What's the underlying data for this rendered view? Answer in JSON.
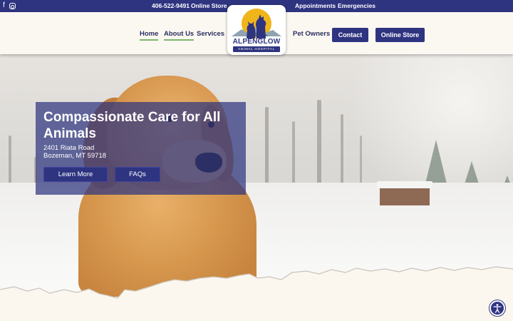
{
  "topbar": {
    "social": {
      "facebook_icon": "f",
      "instagram_icon": "instagram-icon"
    },
    "phone": "406-522-9491",
    "online_store": "Online Store",
    "appointments": "Appointments",
    "emergencies": "Emergencies"
  },
  "nav": {
    "home": "Home",
    "about": "About Us",
    "services": "Services",
    "pet_owners": "Pet Owners",
    "contact": "Contact",
    "online_store": "Online Store"
  },
  "logo": {
    "brand": "ALPENGLOW",
    "sub": "ANIMAL HOSPITAL"
  },
  "hero": {
    "heading": "Compassionate Care for All Animals",
    "address_line1": "2401 Riata Road",
    "address_line2": "Bozeman, MT 59718",
    "learn_more": "Learn More",
    "faqs": "FAQs"
  },
  "colors": {
    "brand_navy": "#2e3480",
    "accent_green": "#7ab86a",
    "sun_yellow": "#f1b51c"
  },
  "accessibility": {
    "icon": "accessibility-icon"
  }
}
